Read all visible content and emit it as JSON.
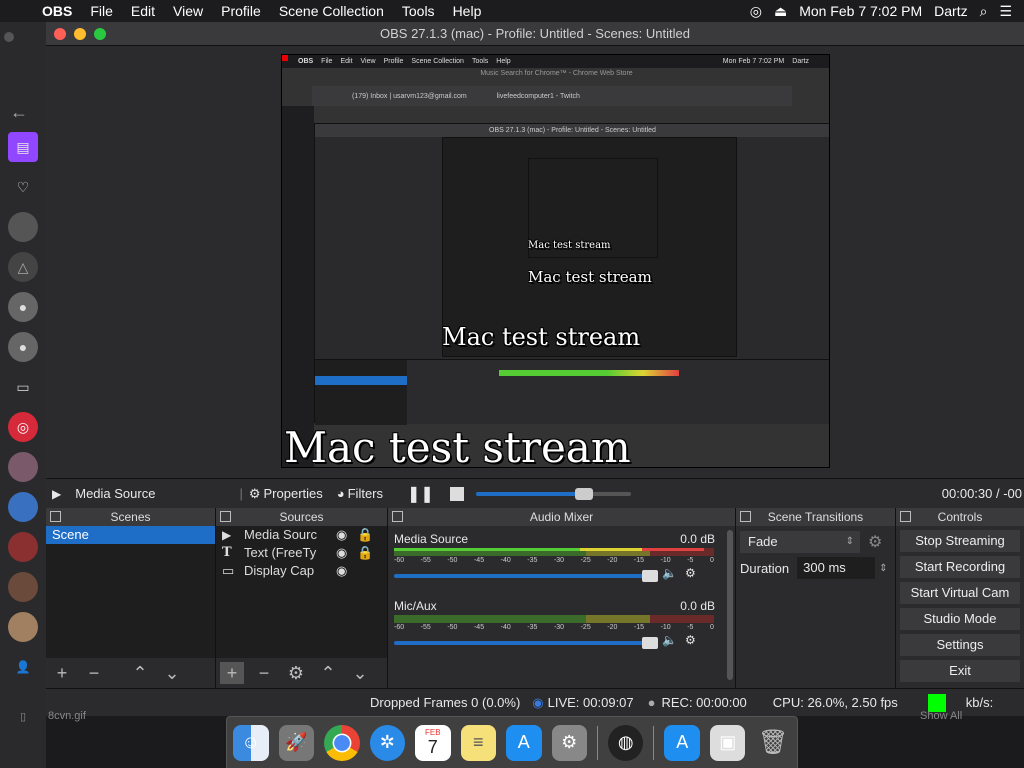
{
  "menubar": {
    "app_name": "OBS",
    "items": [
      "File",
      "Edit",
      "View",
      "Profile",
      "Scene Collection",
      "Tools",
      "Help"
    ],
    "datetime": "Mon Feb 7  7:02 PM",
    "user": "Dartz"
  },
  "window": {
    "title": "OBS 27.1.3 (mac) - Profile: Untitled - Scenes: Untitled"
  },
  "preview": {
    "overlay_text": "Mac test stream",
    "inner_menubar": [
      "OBS",
      "File",
      "Edit",
      "View",
      "Profile",
      "Scene Collection",
      "Tools",
      "Help"
    ],
    "inner_datetime": "Mon Feb 7  7:02 PM",
    "inner_user": "Dartz",
    "inner_window_title": "Music Search for Chrome™ - Chrome Web Store",
    "tab1": "(179) Inbox | usarvm123@gmail.com",
    "tab2": "livefeedcomputer1 - Twitch",
    "nested_obs_title": "OBS 27.1.3 (mac) - Profile: Untitled - Scenes: Untitled"
  },
  "source_bar": {
    "source_name": "Media Source",
    "properties_label": "Properties",
    "filters_label": "Filters",
    "time": "00:00:30 / -00",
    "seek_progress": 0.7
  },
  "scenes": {
    "header": "Scenes",
    "items": [
      "Scene"
    ]
  },
  "sources": {
    "header": "Sources",
    "items": [
      {
        "icon": "play-icon",
        "label": "Media Sourc"
      },
      {
        "icon": "text-icon",
        "label": "Text (FreeTy"
      },
      {
        "icon": "monitor-icon",
        "label": "Display Cap"
      }
    ]
  },
  "mixer": {
    "header": "Audio Mixer",
    "channels": [
      {
        "name": "Media Source",
        "level": "0.0 dB",
        "meter_fill": 0.97
      },
      {
        "name": "Mic/Aux",
        "level": "0.0 dB",
        "meter_fill": 0.0
      }
    ],
    "scale": [
      "-60",
      "-55",
      "-50",
      "-45",
      "-40",
      "-35",
      "-30",
      "-25",
      "-20",
      "-15",
      "-10",
      "-5",
      "0"
    ]
  },
  "transitions": {
    "header": "Scene Transitions",
    "selected": "Fade",
    "duration_label": "Duration",
    "duration_value": "300 ms"
  },
  "controls": {
    "header": "Controls",
    "buttons": [
      "Stop Streaming",
      "Start Recording",
      "Start Virtual Cam",
      "Studio Mode",
      "Settings",
      "Exit"
    ]
  },
  "status": {
    "dropped": "Dropped Frames 0 (0.0%)",
    "live": "LIVE: 00:09:07",
    "rec": "REC: 00:00:00",
    "cpu": "CPU: 26.0%, 2.50 fps",
    "kbs": "kb/s:",
    "stream_color": "#00ff00"
  },
  "background": {
    "file_name": "8cvn.gif",
    "show_all": "Show All"
  },
  "dock": {
    "apps": [
      "finder-icon",
      "launchpad-icon",
      "chrome-icon",
      "safari-icon",
      "calendar-icon",
      "notes-icon",
      "appstore-icon",
      "settings-icon",
      "obs-icon",
      "appstore-icon",
      "photo-icon",
      "trash-icon"
    ],
    "calendar_month": "FEB",
    "calendar_day": "7"
  }
}
